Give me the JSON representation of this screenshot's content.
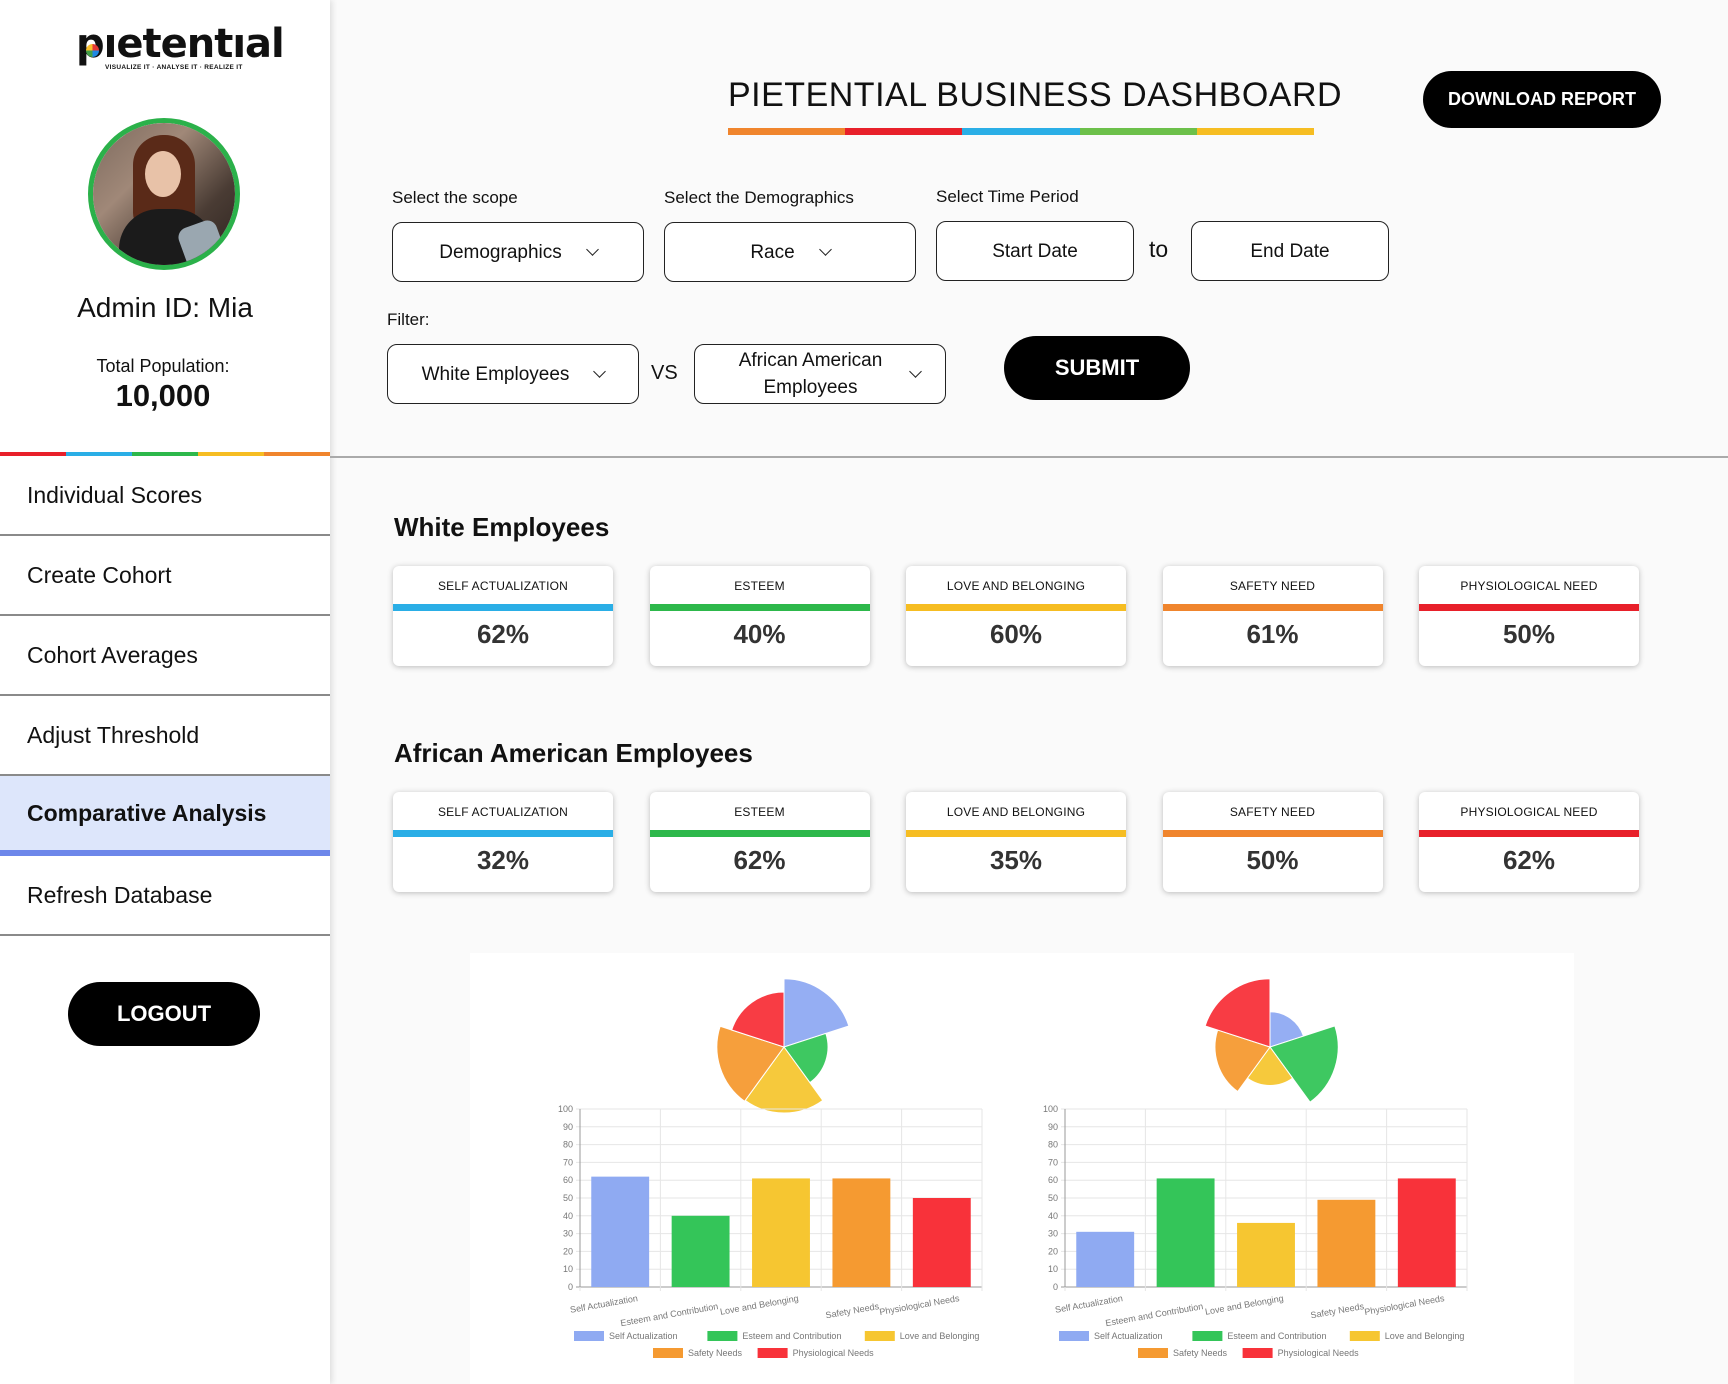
{
  "brand": {
    "name": "pıetentıal",
    "tagline": "VISUALIZE IT · ANALYSE IT · REALIZE IT"
  },
  "profile": {
    "admin": "Admin ID: Mia",
    "population_label": "Total Population:",
    "population_value": "10,000"
  },
  "nav": [
    {
      "label": "Individual Scores",
      "active": false
    },
    {
      "label": "Create Cohort",
      "active": false
    },
    {
      "label": "Cohort Averages",
      "active": false
    },
    {
      "label": "Adjust Threshold",
      "active": false
    },
    {
      "label": "Comparative Analysis",
      "active": true
    },
    {
      "label": "Refresh Database",
      "active": false
    }
  ],
  "logout_label": "LOGOUT",
  "header": {
    "title": "PIETENTIAL BUSINESS DASHBOARD",
    "download_label": "DOWNLOAD REPORT"
  },
  "controls": {
    "scope_label": "Select the scope",
    "scope_value": "Demographics",
    "demo_label": "Select the Demographics",
    "demo_value": "Race",
    "time_label": "Select Time Period",
    "start_date": "Start Date",
    "to": "to",
    "end_date": "End Date",
    "filter_label": "Filter:",
    "filter_a": "White Employees",
    "vs": "VS",
    "filter_b": "African American Employees",
    "submit_label": "SUBMIT"
  },
  "colors": {
    "self": "#2aaee6",
    "esteem": "#2db84b",
    "love": "#f6bd22",
    "safety": "#f0852d",
    "phys": "#e8202a",
    "series": [
      "#8faaf2",
      "#34c559",
      "#f6c631",
      "#f59a31",
      "#f8323a"
    ]
  },
  "groups": [
    {
      "title": "White Employees",
      "cards": [
        {
          "label": "SELF ACTUALIZATION",
          "value": "62%",
          "color": "#2aaee6"
        },
        {
          "label": "ESTEEM",
          "value": "40%",
          "color": "#2db84b"
        },
        {
          "label": "LOVE AND BELONGING",
          "value": "60%",
          "color": "#f6bd22"
        },
        {
          "label": "SAFETY NEED",
          "value": "61%",
          "color": "#f0852d"
        },
        {
          "label": "PHYSIOLOGICAL NEED",
          "value": "50%",
          "color": "#e8202a"
        }
      ]
    },
    {
      "title": "African American Employees",
      "cards": [
        {
          "label": "SELF ACTUALIZATION",
          "value": "32%",
          "color": "#2aaee6"
        },
        {
          "label": "ESTEEM",
          "value": "62%",
          "color": "#2db84b"
        },
        {
          "label": "LOVE AND BELONGING",
          "value": "35%",
          "color": "#f6bd22"
        },
        {
          "label": "SAFETY NEED",
          "value": "50%",
          "color": "#f0852d"
        },
        {
          "label": "PHYSIOLOGICAL NEED",
          "value": "62%",
          "color": "#e8202a"
        }
      ]
    }
  ],
  "chart_data": [
    {
      "type": "pie",
      "subtype": "polar-area",
      "categories": [
        "Self Actualization",
        "Esteem and Contribution",
        "Love and Belonging",
        "Safety Needs",
        "Physiological Needs"
      ],
      "values": [
        62,
        40,
        60,
        61,
        50
      ]
    },
    {
      "type": "bar",
      "categories": [
        "Self Actualization",
        "Esteem and Contribution",
        "Love and Belonging",
        "Safety Needs",
        "Physiological Needs"
      ],
      "values": [
        62,
        40,
        61,
        61,
        50
      ],
      "ylim": [
        0,
        100
      ],
      "yticks": [
        0,
        10,
        20,
        30,
        40,
        50,
        60,
        70,
        80,
        90,
        100
      ],
      "grid": true,
      "legend": "bottom"
    },
    {
      "type": "pie",
      "subtype": "polar-area",
      "categories": [
        "Self Actualization",
        "Esteem and Contribution",
        "Love and Belonging",
        "Safety Needs",
        "Physiological Needs"
      ],
      "values": [
        32,
        62,
        35,
        50,
        62
      ]
    },
    {
      "type": "bar",
      "categories": [
        "Self Actualization",
        "Esteem and Contribution",
        "Love and Belonging",
        "Safety Needs",
        "Physiological Needs"
      ],
      "values": [
        31,
        61,
        36,
        49,
        61
      ],
      "ylim": [
        0,
        100
      ],
      "yticks": [
        0,
        10,
        20,
        30,
        40,
        50,
        60,
        70,
        80,
        90,
        100
      ],
      "grid": true,
      "legend": "bottom"
    }
  ]
}
